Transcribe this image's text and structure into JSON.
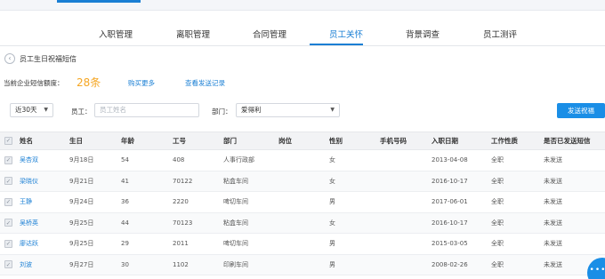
{
  "tabs": [
    {
      "label": "入职管理",
      "active": false
    },
    {
      "label": "离职管理",
      "active": false
    },
    {
      "label": "合同管理",
      "active": false
    },
    {
      "label": "员工关怀",
      "active": true
    },
    {
      "label": "背景调查",
      "active": false
    },
    {
      "label": "员工测评",
      "active": false
    }
  ],
  "page": {
    "title": "员工生日祝福短信",
    "back_icon": "chevron-left-icon"
  },
  "quota": {
    "label": "当前企业短信额度：",
    "value": "28条",
    "buy_more": "购买更多",
    "view_records": "查看发送记录"
  },
  "filters": {
    "period": "近30天",
    "employee_label": "员工：",
    "employee_placeholder": "员工姓名",
    "dept_label": "部门：",
    "dept_value": "爱得利",
    "send_button": "发送祝福"
  },
  "table": {
    "columns": [
      "姓名",
      "生日",
      "年龄",
      "工号",
      "部门",
      "岗位",
      "性别",
      "手机号码",
      "入职日期",
      "工作性质",
      "是否已发送短信"
    ],
    "rows": [
      [
        "吴杏双",
        "9月18日",
        "54",
        "408",
        "人事行政部",
        "",
        "女",
        "",
        "2013-04-08",
        "全职",
        "未发送"
      ],
      [
        "梁晓仪",
        "9月21日",
        "41",
        "70122",
        "粘盒车间",
        "",
        "女",
        "",
        "2016-10-17",
        "全职",
        "未发送"
      ],
      [
        "王静",
        "9月24日",
        "36",
        "2220",
        "啤切车间",
        "",
        "男",
        "",
        "2017-06-01",
        "全职",
        "未发送"
      ],
      [
        "吴桥英",
        "9月25日",
        "44",
        "70123",
        "粘盒车间",
        "",
        "女",
        "",
        "2016-10-17",
        "全职",
        "未发送"
      ],
      [
        "廖达跃",
        "9月25日",
        "29",
        "2011",
        "啤切车间",
        "",
        "男",
        "",
        "2015-03-05",
        "全职",
        "未发送"
      ],
      [
        "刘波",
        "9月27日",
        "30",
        "1102",
        "印刷车间",
        "",
        "男",
        "",
        "2008-02-26",
        "全职",
        "未发送"
      ]
    ]
  },
  "colors": {
    "accent": "#1a7fd4",
    "quota_number": "#f5a623",
    "primary_button": "#1a8ee6"
  },
  "chat": {
    "icon": "chat-bubble-icon",
    "glyph": "•••"
  }
}
